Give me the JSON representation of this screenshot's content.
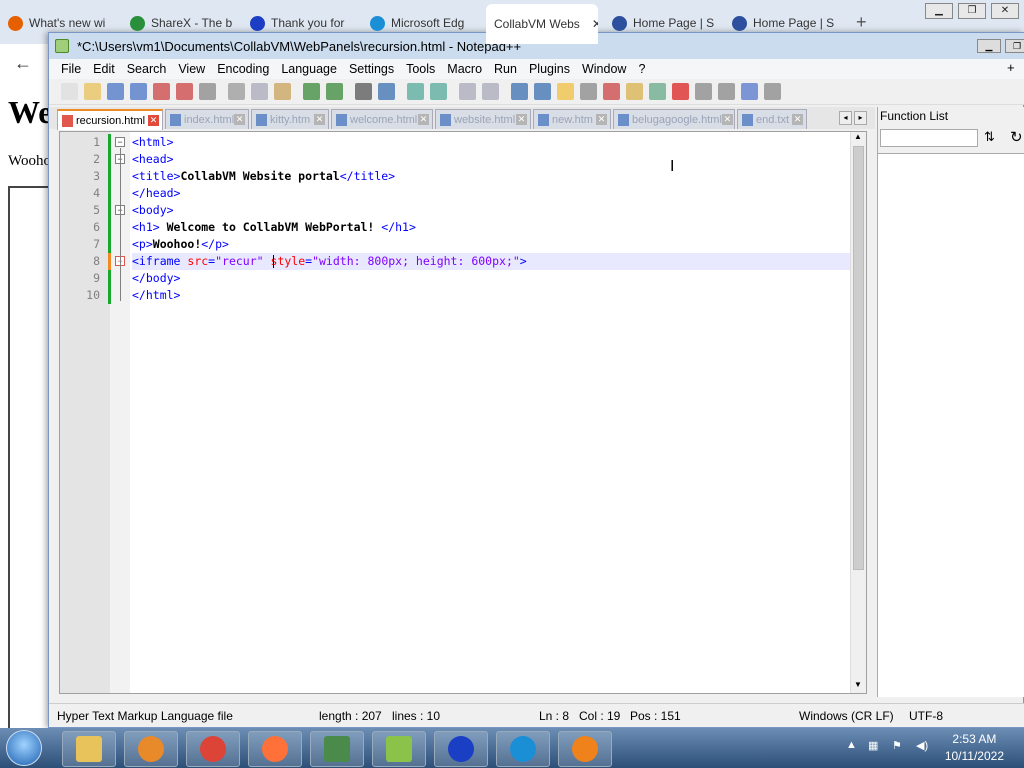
{
  "browser": {
    "tabs": [
      {
        "title": "What's new wi",
        "color": "#e66000"
      },
      {
        "title": "ShareX - The b",
        "color": "#2a8f3b"
      },
      {
        "title": "Thank you for",
        "color": "#1b3ec4"
      },
      {
        "title": "Microsoft Edg",
        "color": "#1a8fd6"
      },
      {
        "title": "CollabVM Webs",
        "color": "#ffffff"
      },
      {
        "title": "Home Page | S",
        "color": "#2c4f9e"
      },
      {
        "title": "Home Page | S",
        "color": "#2c4f9e"
      }
    ],
    "new_tab": "+",
    "back": "←",
    "page_heading": "Welcome to CollabVM WebPortal!",
    "page_text": "Woohoo!"
  },
  "npp": {
    "title": "*C:\\Users\\vm1\\Documents\\CollabVM\\WebPanels\\recursion.html - Notepad++",
    "menu": [
      "File",
      "Edit",
      "Search",
      "View",
      "Encoding",
      "Language",
      "Settings",
      "Tools",
      "Macro",
      "Run",
      "Plugins",
      "Window",
      "?"
    ],
    "menu_plus": "+",
    "menu_close": "x",
    "tabs": [
      {
        "label": "recursion.html",
        "active": true
      },
      {
        "label": "index.html",
        "active": false
      },
      {
        "label": "kitty.htm",
        "active": false
      },
      {
        "label": "welcome.html",
        "active": false
      },
      {
        "label": "website.html",
        "active": false
      },
      {
        "label": "new.htm",
        "active": false
      },
      {
        "label": "belugagoogle.html",
        "active": false
      },
      {
        "label": "end.txt",
        "active": false
      }
    ],
    "lines": [
      {
        "n": "1",
        "parts": [
          [
            "tag",
            "<html>"
          ]
        ]
      },
      {
        "n": "2",
        "parts": [
          [
            "tag",
            "<head>"
          ]
        ]
      },
      {
        "n": "3",
        "parts": [
          [
            "tag",
            "<title>"
          ],
          [
            "txt",
            "CollabVM Website portal"
          ],
          [
            "tag",
            "</title>"
          ]
        ]
      },
      {
        "n": "4",
        "parts": [
          [
            "tag",
            "</head>"
          ]
        ]
      },
      {
        "n": "5",
        "parts": [
          [
            "tag",
            "<body>"
          ]
        ]
      },
      {
        "n": "6",
        "parts": [
          [
            "tag",
            "<h1>"
          ],
          [
            "txt",
            " Welcome to CollabVM WebPortal! "
          ],
          [
            "tag",
            "</h1>"
          ]
        ]
      },
      {
        "n": "7",
        "parts": [
          [
            "tag",
            "<p>"
          ],
          [
            "txt",
            "Woohoo!"
          ],
          [
            "tag",
            "</p>"
          ]
        ]
      },
      {
        "n": "8",
        "parts": [
          [
            "tag",
            "<iframe "
          ],
          [
            "attr",
            "src"
          ],
          [
            "tag",
            "="
          ],
          [
            "str",
            "\"recur\""
          ],
          [
            "tag",
            " "
          ],
          [
            "attr",
            "style"
          ],
          [
            "tag",
            "="
          ],
          [
            "str",
            "\"width: 800px; height: 600px;\""
          ],
          [
            "tag",
            ">"
          ]
        ]
      },
      {
        "n": "9",
        "parts": [
          [
            "tag",
            "</body>"
          ]
        ]
      },
      {
        "n": "10",
        "parts": [
          [
            "tag",
            "</html>"
          ]
        ]
      }
    ],
    "function_list": {
      "title": "Function List"
    },
    "status": {
      "filetype": "Hyper Text Markup Language file",
      "length": "length : 207",
      "lines": "lines : 10",
      "ln": "Ln : 8",
      "col": "Col : 19",
      "pos": "Pos : 151",
      "eol": "Windows (CR LF)",
      "encoding": "UTF-8"
    }
  },
  "taskbar": {
    "time": "2:53 AM",
    "date": "10/11/2022",
    "apps": [
      "explorer-icon",
      "media-player-icon",
      "chrome-icon",
      "firefox-icon",
      "terminal-icon",
      "notepadpp-icon",
      "malwarebytes-icon",
      "edge-icon",
      "firefox-dev-icon"
    ]
  }
}
